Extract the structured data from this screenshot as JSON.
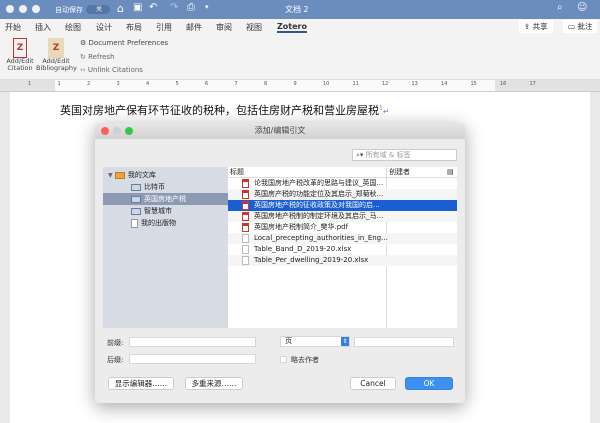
{
  "window": {
    "title": "文档 2",
    "autosave_label": "自动保存",
    "autosave_state": "关"
  },
  "tabs": [
    "开始",
    "插入",
    "绘图",
    "设计",
    "布局",
    "引用",
    "邮件",
    "审阅",
    "视图",
    "Zotero"
  ],
  "active_tab": "Zotero",
  "header_buttons": {
    "share": "共享",
    "comment": "批注"
  },
  "ribbon": {
    "add_edit_citation": "Add/Edit Citation",
    "add_edit_bibliography": "Add/Edit Bibliography",
    "doc_prefs": "Document Preferences",
    "refresh": "Refresh",
    "unlink": "Unlink Citations"
  },
  "ruler": [
    "1",
    "1",
    "2",
    "3",
    "4",
    "5",
    "6",
    "7",
    "8",
    "9",
    "10",
    "11",
    "12",
    "13",
    "14",
    "15",
    "16",
    "17"
  ],
  "document": {
    "text": "英国对房地产保有环节征收的税种，包括住房财产税和营业房屋税"
  },
  "dialog": {
    "title": "添加/编辑引文",
    "search_placeholder": "所有域 & 标签",
    "library": {
      "root": "我的文库",
      "items": [
        "比特币",
        "英国房地产税",
        "智慧城市",
        "我的出版物"
      ],
      "selected": "英国房地产税"
    },
    "columns": {
      "title": "标题",
      "creator": "创建者"
    },
    "items": [
      {
        "title": "论我国房地产税改革的思路与建议_英国...",
        "type": "pdf"
      },
      {
        "title": "英国房产税的功能定位及其启示_郑菊秋...",
        "type": "pdf"
      },
      {
        "title": "英国房地产税的征收政策及对我国的启...",
        "type": "pdf"
      },
      {
        "title": "英国房地产税制的制定环境及其启示_马...",
        "type": "pdf"
      },
      {
        "title": "英国房地产税制简介_樊华.pdf",
        "type": "pdf"
      },
      {
        "title": "Local_precepting_authorities_in_Eng...",
        "type": "file"
      },
      {
        "title": "Table_Band_D_2019-20.xlsx",
        "type": "file"
      },
      {
        "title": "Table_Per_dwelling_2019-20.xlsx",
        "type": "file"
      }
    ],
    "selected_index": 2,
    "prefix_label": "前缀:",
    "suffix_label": "后缀:",
    "locator_select": "页",
    "suppress_author": "略去作者",
    "show_editor": "显示编辑器……",
    "multiple_sources": "多重来源……",
    "cancel": "Cancel",
    "ok": "OK"
  }
}
